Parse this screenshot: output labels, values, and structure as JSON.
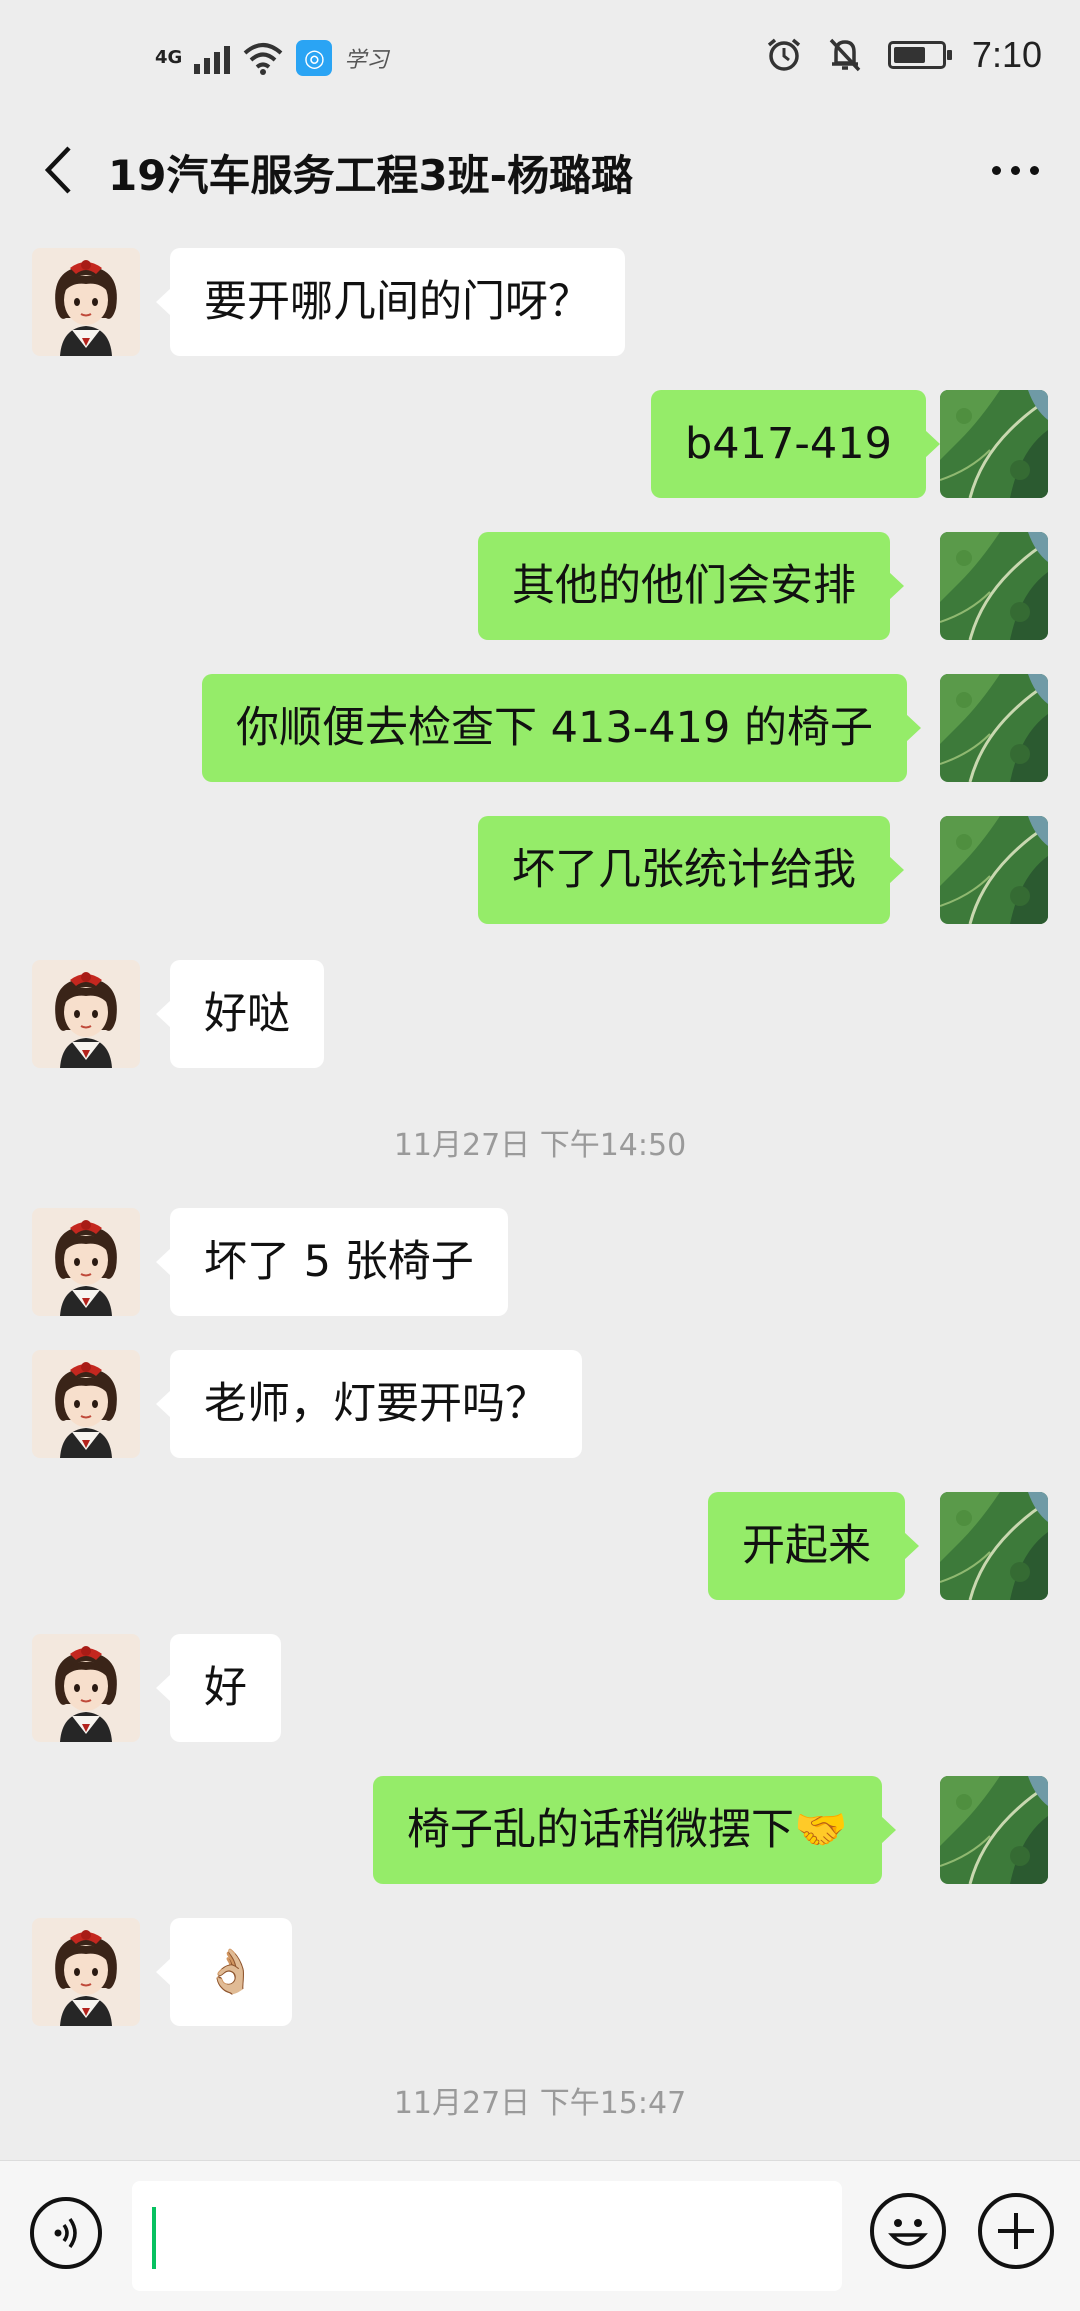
{
  "status_bar": {
    "network": "4G",
    "app_label": "学习",
    "time": "7:10"
  },
  "header": {
    "title": "19汽车服务工程3班-杨璐璐"
  },
  "messages": [
    {
      "side": "in",
      "text": "要开哪几间的门呀？"
    },
    {
      "side": "out",
      "text": "b417-419"
    },
    {
      "side": "out",
      "text": "其他的他们会安排"
    },
    {
      "side": "out",
      "text": "你顺便去检查下 413-419 的椅子"
    },
    {
      "side": "out",
      "text": "坏了几张统计给我"
    },
    {
      "side": "in",
      "text": "好哒"
    },
    {
      "side": "in",
      "text": "坏了 5 张椅子"
    },
    {
      "side": "in",
      "text": "老师，灯要开吗？"
    },
    {
      "side": "out",
      "text": "开起来"
    },
    {
      "side": "in",
      "text": "好"
    },
    {
      "side": "out",
      "text": "椅子乱的话稍微摆下🤝"
    },
    {
      "side": "in",
      "text": "👌🏼"
    }
  ],
  "timestamps": [
    "11月27日 下午14:50",
    "11月27日 下午15:47"
  ],
  "input": {
    "value": ""
  },
  "colors": {
    "background": "#ededed",
    "outgoing_bubble": "#95ec69",
    "incoming_bubble": "#ffffff",
    "timestamp_text": "#9a9a9a",
    "cursor": "#07c160"
  }
}
